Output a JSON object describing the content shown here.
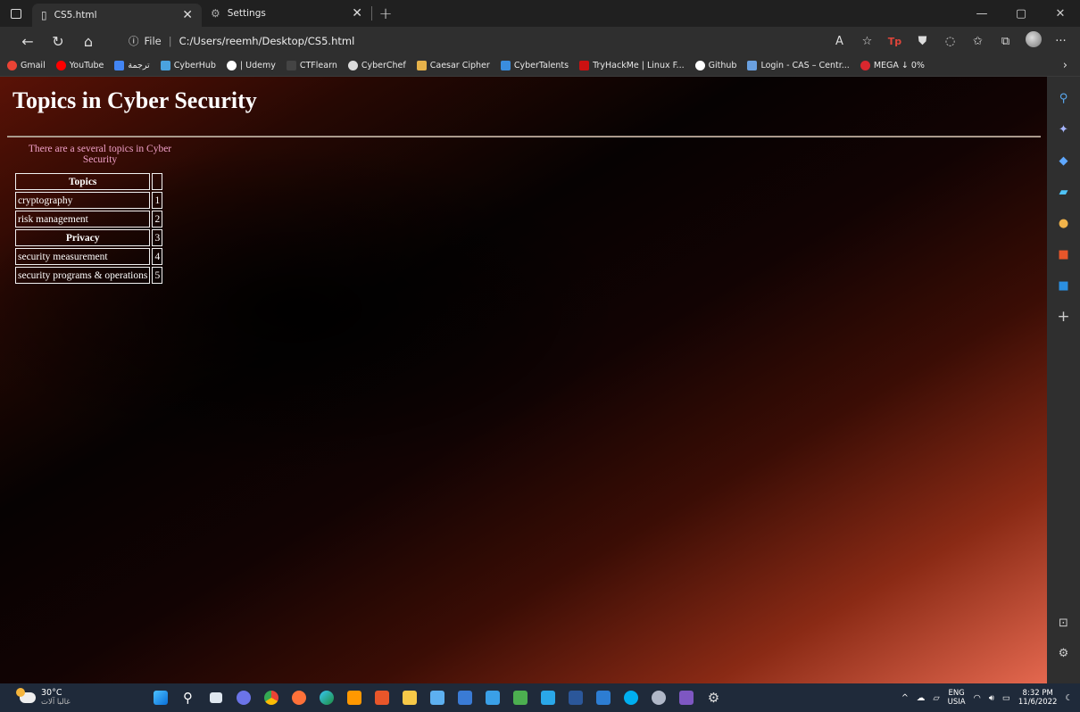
{
  "browser": {
    "tabs": [
      {
        "title": "CS5.html",
        "active": true
      },
      {
        "title": "Settings",
        "active": false
      }
    ],
    "address": {
      "scheme_label": "File",
      "url": "C:/Users/reemh/Desktop/CS5.html"
    },
    "bookmarks": [
      {
        "label": "Gmail",
        "color": "#ea4335"
      },
      {
        "label": "YouTube",
        "color": "#ff0000"
      },
      {
        "label": "ترجمة",
        "color": "#4285f4"
      },
      {
        "label": "CyberHub",
        "color": "#4aa3df"
      },
      {
        "label": "| Udemy",
        "color": "#ffffff"
      },
      {
        "label": "CTFlearn",
        "color": "#333333"
      },
      {
        "label": "CyberChef",
        "color": "#dddddd"
      },
      {
        "label": "Caesar Cipher",
        "color": "#e6b24a"
      },
      {
        "label": "CyberTalents",
        "color": "#3a8dde"
      },
      {
        "label": "TryHackMe | Linux F...",
        "color": "#c11"
      },
      {
        "label": "Github",
        "color": "#ffffff"
      },
      {
        "label": "Login - CAS – Centr...",
        "color": "#6aa0e0"
      },
      {
        "label": "MEGA ↓ 0%",
        "color": "#d9272e"
      }
    ]
  },
  "page": {
    "title": "Topics in Cyber Security",
    "caption": "There are a several topics in Cyber Security",
    "table": {
      "header1": "Topics",
      "rows": [
        {
          "label": "cryptography",
          "num": "1"
        },
        {
          "label": "risk management",
          "num": "2"
        }
      ],
      "header2": "Privacy",
      "header2_num": "3",
      "rows2": [
        {
          "label": "security measurement",
          "num": "4"
        },
        {
          "label": "security programs & operations",
          "num": "5"
        }
      ]
    }
  },
  "taskbar": {
    "weather_temp": "30°C",
    "weather_sub": "غالبا آلات",
    "lang_top": "ENG",
    "lang_bottom": "USIA",
    "time": "8:32 PM",
    "date": "11/6/2022"
  }
}
